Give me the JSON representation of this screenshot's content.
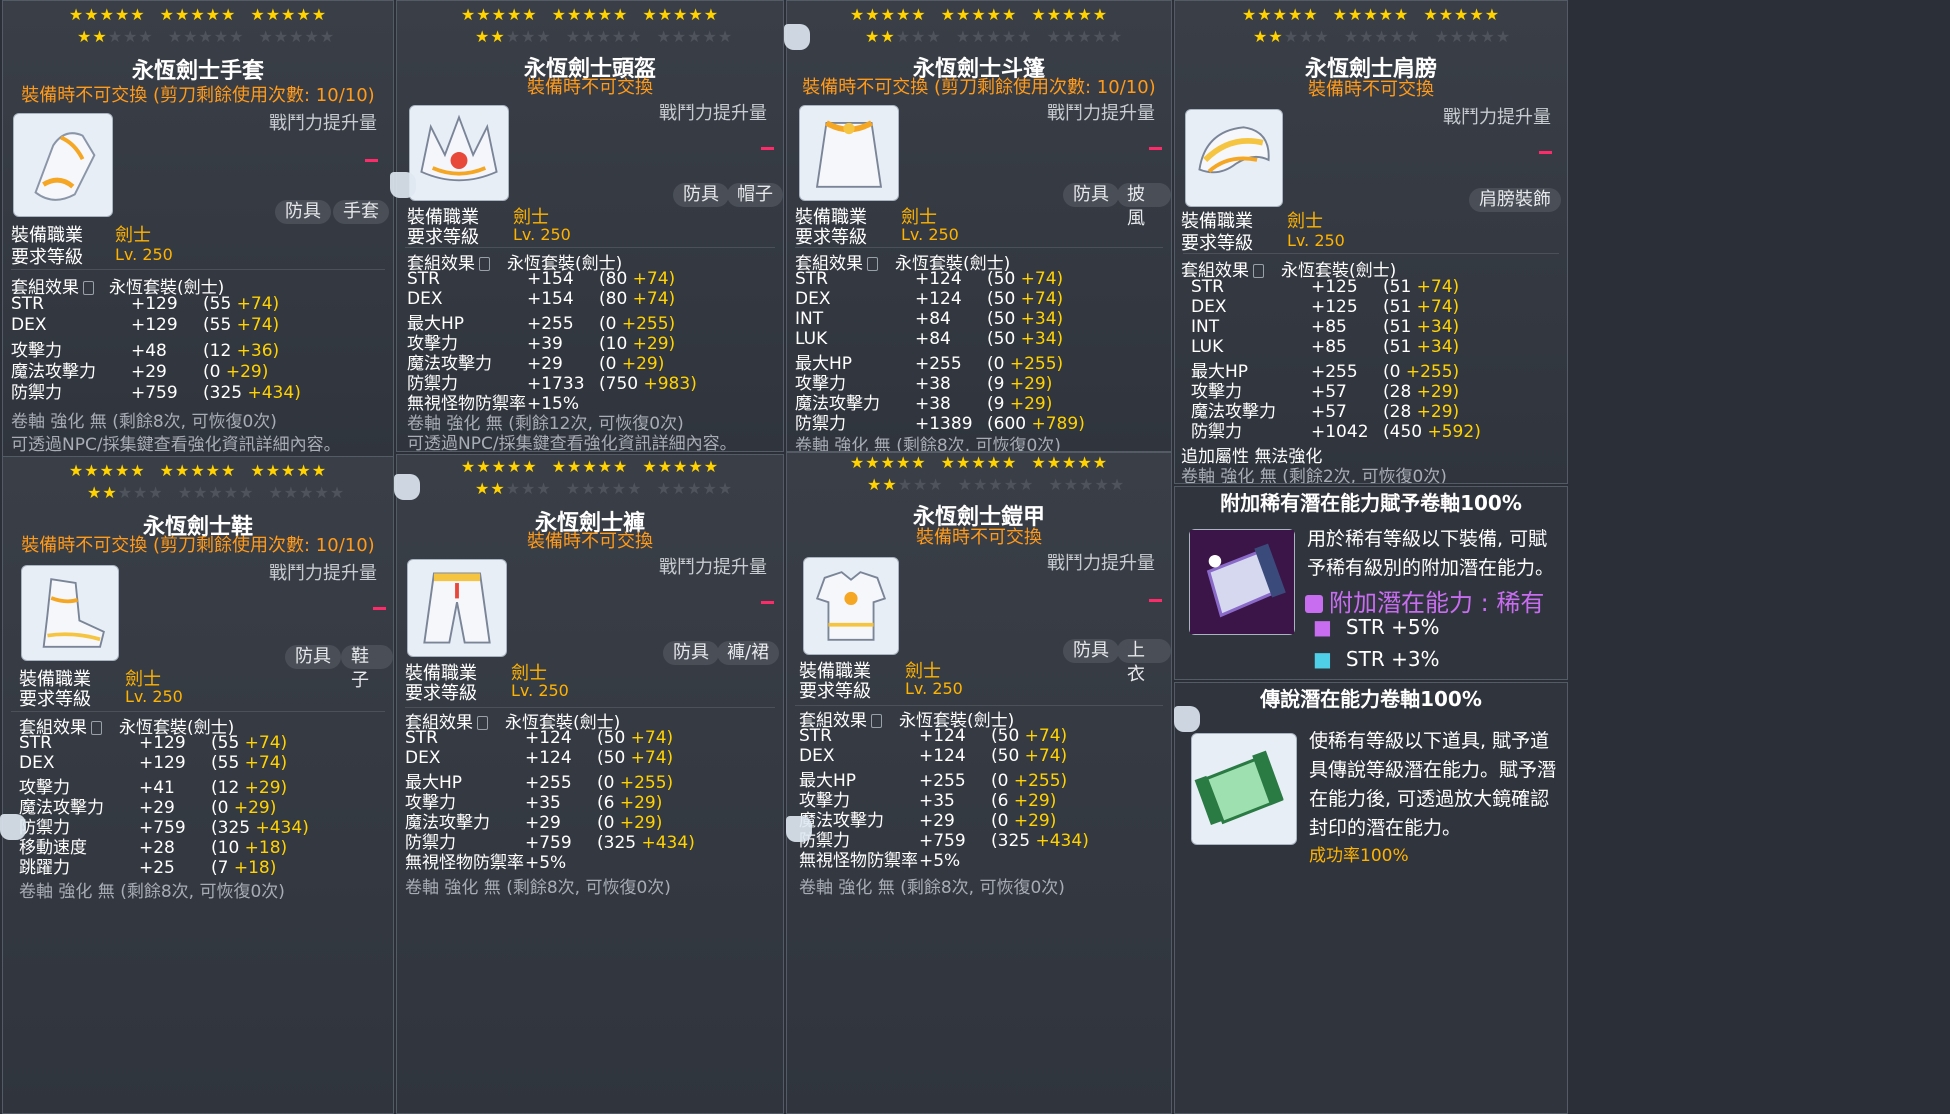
{
  "labels": {
    "power": "戰鬥力提升量",
    "req_job": "裝備職業",
    "req_level": "要求等級",
    "job": "劍士",
    "level": "Lv. 250",
    "set_effect": "套組效果",
    "set_name": "永恆套裝(劍士)",
    "npc_note": "可透過NPC/採集鍵查看強化資訊詳細內容。",
    "extra_attr": "追加屬性 無法強化"
  },
  "items": [
    {
      "name": "永恆劍士手套",
      "tradeable": "裝備時不可交換 (剪刀剩餘使用次數: 10/10)",
      "tags": [
        "防具",
        "手套"
      ],
      "stats": [
        {
          "name": "STR",
          "value": "+129",
          "base": "(55",
          "bonus": "+74)"
        },
        {
          "name": "DEX",
          "value": "+129",
          "base": "(55",
          "bonus": "+74)"
        },
        {
          "name": "攻擊力",
          "value": "+48",
          "base": "(12",
          "bonus": "+36)"
        },
        {
          "name": "魔法攻擊力",
          "value": "+29",
          "base": "(0",
          "bonus": "+29)"
        },
        {
          "name": "防禦力",
          "value": "+759",
          "base": "(325",
          "bonus": "+434)"
        }
      ],
      "scroll": "卷軸 強化 無 (剩餘8次, 可恢復0次)"
    },
    {
      "name": "永恆劍士頭盔",
      "tradeable": "裝備時不可交換",
      "tags": [
        "防具",
        "帽子"
      ],
      "stats": [
        {
          "name": "STR",
          "value": "+154",
          "base": "(80",
          "bonus": "+74)"
        },
        {
          "name": "DEX",
          "value": "+154",
          "base": "(80",
          "bonus": "+74)"
        },
        {
          "name": "最大HP",
          "value": "+255",
          "base": "(0",
          "bonus": "+255)"
        },
        {
          "name": "攻擊力",
          "value": "+39",
          "base": "(10",
          "bonus": "+29)"
        },
        {
          "name": "魔法攻擊力",
          "value": "+29",
          "base": "(0",
          "bonus": "+29)"
        },
        {
          "name": "防禦力",
          "value": "+1733",
          "base": "(750",
          "bonus": "+983)"
        },
        {
          "name": "無視怪物防禦率",
          "value": "+15%",
          "base": "",
          "bonus": ""
        }
      ],
      "scroll": "卷軸 強化 無 (剩餘12次, 可恢復0次)"
    },
    {
      "name": "永恆劍士斗篷",
      "tradeable": "裝備時不可交換 (剪刀剩餘使用次數: 10/10)",
      "tags": [
        "防具",
        "披風"
      ],
      "stats": [
        {
          "name": "STR",
          "value": "+124",
          "base": "(50",
          "bonus": "+74)"
        },
        {
          "name": "DEX",
          "value": "+124",
          "base": "(50",
          "bonus": "+74)"
        },
        {
          "name": "INT",
          "value": "+84",
          "base": "(50",
          "bonus": "+34)"
        },
        {
          "name": "LUK",
          "value": "+84",
          "base": "(50",
          "bonus": "+34)"
        },
        {
          "name": "最大HP",
          "value": "+255",
          "base": "(0",
          "bonus": "+255)"
        },
        {
          "name": "攻擊力",
          "value": "+38",
          "base": "(9",
          "bonus": "+29)"
        },
        {
          "name": "魔法攻擊力",
          "value": "+38",
          "base": "(9",
          "bonus": "+29)"
        },
        {
          "name": "防禦力",
          "value": "+1389",
          "base": "(600",
          "bonus": "+789)"
        }
      ],
      "scroll": "卷軸 強化 無 (剩餘8次, 可恢復0次)"
    },
    {
      "name": "永恆劍士肩膀",
      "tradeable": "裝備時不可交換",
      "tags": [
        "肩膀裝飾"
      ],
      "stats": [
        {
          "name": "STR",
          "value": "+125",
          "base": "(51",
          "bonus": "+74)"
        },
        {
          "name": "DEX",
          "value": "+125",
          "base": "(51",
          "bonus": "+74)"
        },
        {
          "name": "INT",
          "value": "+85",
          "base": "(51",
          "bonus": "+34)"
        },
        {
          "name": "LUK",
          "value": "+85",
          "base": "(51",
          "bonus": "+34)"
        },
        {
          "name": "最大HP",
          "value": "+255",
          "base": "(0",
          "bonus": "+255)"
        },
        {
          "name": "攻擊力",
          "value": "+57",
          "base": "(28",
          "bonus": "+29)"
        },
        {
          "name": "魔法攻擊力",
          "value": "+57",
          "base": "(28",
          "bonus": "+29)"
        },
        {
          "name": "防禦力",
          "value": "+1042",
          "base": "(450",
          "bonus": "+592)"
        }
      ],
      "scroll": "卷軸 強化 無 (剩餘2次, 可恢復0次)"
    },
    {
      "name": "永恆劍士鞋",
      "tradeable": "裝備時不可交換 (剪刀剩餘使用次數: 10/10)",
      "tags": [
        "防具",
        "鞋子"
      ],
      "stats": [
        {
          "name": "STR",
          "value": "+129",
          "base": "(55",
          "bonus": "+74)"
        },
        {
          "name": "DEX",
          "value": "+129",
          "base": "(55",
          "bonus": "+74)"
        },
        {
          "name": "攻擊力",
          "value": "+41",
          "base": "(12",
          "bonus": "+29)"
        },
        {
          "name": "魔法攻擊力",
          "value": "+29",
          "base": "(0",
          "bonus": "+29)"
        },
        {
          "name": "防禦力",
          "value": "+759",
          "base": "(325",
          "bonus": "+434)"
        },
        {
          "name": "移動速度",
          "value": "+28",
          "base": "(10",
          "bonus": "+18)"
        },
        {
          "name": "跳躍力",
          "value": "+25",
          "base": "(7",
          "bonus": "+18)"
        }
      ],
      "scroll": "卷軸 強化 無 (剩餘8次, 可恢復0次)"
    },
    {
      "name": "永恆劍士褲",
      "tradeable": "裝備時不可交換",
      "tags": [
        "防具",
        "褲/裙"
      ],
      "stats": [
        {
          "name": "STR",
          "value": "+124",
          "base": "(50",
          "bonus": "+74)"
        },
        {
          "name": "DEX",
          "value": "+124",
          "base": "(50",
          "bonus": "+74)"
        },
        {
          "name": "最大HP",
          "value": "+255",
          "base": "(0",
          "bonus": "+255)"
        },
        {
          "name": "攻擊力",
          "value": "+35",
          "base": "(6",
          "bonus": "+29)"
        },
        {
          "name": "魔法攻擊力",
          "value": "+29",
          "base": "(0",
          "bonus": "+29)"
        },
        {
          "name": "防禦力",
          "value": "+759",
          "base": "(325",
          "bonus": "+434)"
        },
        {
          "name": "無視怪物防禦率",
          "value": "+5%",
          "base": "",
          "bonus": ""
        }
      ],
      "scroll": "卷軸 強化 無 (剩餘8次, 可恢復0次)"
    },
    {
      "name": "永恆劍士鎧甲",
      "tradeable": "裝備時不可交換",
      "tags": [
        "防具",
        "上衣"
      ],
      "stats": [
        {
          "name": "STR",
          "value": "+124",
          "base": "(50",
          "bonus": "+74)"
        },
        {
          "name": "DEX",
          "value": "+124",
          "base": "(50",
          "bonus": "+74)"
        },
        {
          "name": "最大HP",
          "value": "+255",
          "base": "(0",
          "bonus": "+255)"
        },
        {
          "name": "攻擊力",
          "value": "+35",
          "base": "(6",
          "bonus": "+29)"
        },
        {
          "name": "魔法攻擊力",
          "value": "+29",
          "base": "(0",
          "bonus": "+29)"
        },
        {
          "name": "防禦力",
          "value": "+759",
          "base": "(325",
          "bonus": "+434)"
        },
        {
          "name": "無視怪物防禦率",
          "value": "+5%",
          "base": "",
          "bonus": ""
        }
      ],
      "scroll": "卷軸 強化 無 (剩餘8次, 可恢復0次)"
    }
  ],
  "scroll_items": [
    {
      "name": "附加稀有潛在能力賦予卷軸100%",
      "desc": "用於稀有等級以下裝備, 可賦予稀有級別的附加潛在能力。",
      "potential_title": "附加潛在能力 : 稀有",
      "potential_lines": [
        "STR +5%",
        "STR +3%"
      ]
    },
    {
      "name": "傳說潛在能力卷軸100%",
      "desc": "使稀有等級以下道具, 賦予道具傳說等級潛在能力。賦予潛在能力後, 可透過放大鏡確認封印的潛在能力。",
      "success": "成功率100%"
    }
  ],
  "colors": {
    "star": "#ffd200",
    "tradeable": "#ff9a1a",
    "bonus": "#ffd200",
    "job": "#ffb300",
    "potential": "#c86cf0",
    "dash": "#ff2a6a"
  }
}
